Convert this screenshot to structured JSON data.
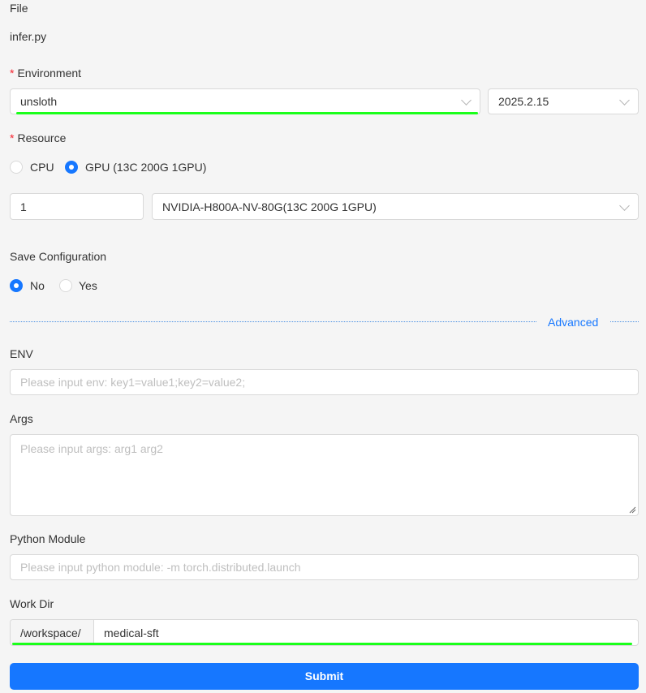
{
  "file": {
    "label": "File",
    "value": "infer.py"
  },
  "environment": {
    "required_mark": "*",
    "label": "Environment",
    "select_value": "unsloth",
    "version_value": "2025.2.15"
  },
  "resource": {
    "required_mark": "*",
    "label": "Resource",
    "options": [
      "CPU",
      "GPU (13C 200G 1GPU)"
    ],
    "selected": "GPU (13C 200G 1GPU)",
    "count_value": "1",
    "gpu_select_value": "NVIDIA-H800A-NV-80G(13C 200G 1GPU)"
  },
  "save_config": {
    "label": "Save Configuration",
    "options": [
      "No",
      "Yes"
    ],
    "selected": "No"
  },
  "advanced": {
    "label": "Advanced"
  },
  "env": {
    "label": "ENV",
    "placeholder": "Please input env: key1=value1;key2=value2;"
  },
  "args": {
    "label": "Args",
    "placeholder": "Please input args: arg1 arg2"
  },
  "python_module": {
    "label": "Python Module",
    "placeholder": "Please input python module: -m torch.distributed.launch"
  },
  "work_dir": {
    "label": "Work Dir",
    "prefix": "/workspace/",
    "value": "medical-sft"
  },
  "submit": {
    "label": "Submit"
  },
  "colors": {
    "primary": "#1677ff",
    "highlight": "#1aff1a",
    "required": "#f5222d"
  }
}
